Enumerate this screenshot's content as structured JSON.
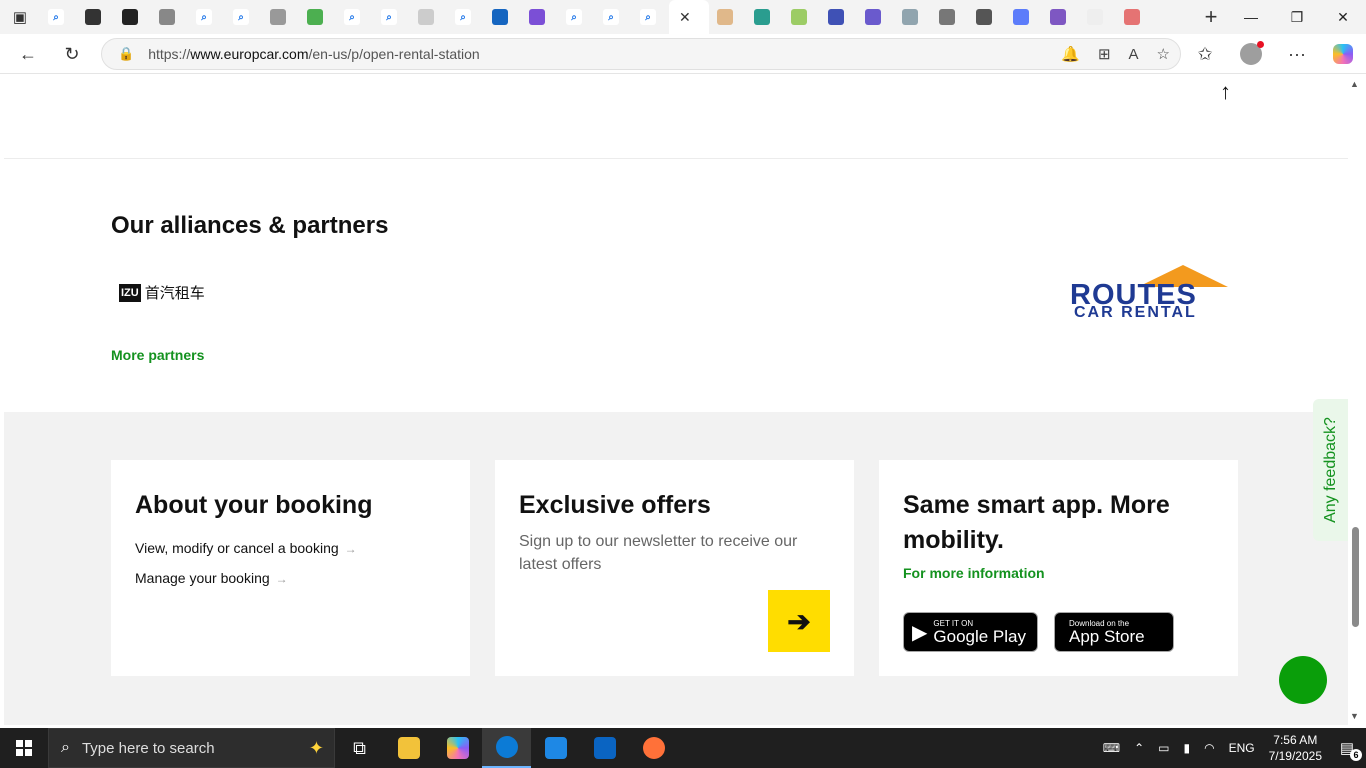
{
  "browser": {
    "tabs": [
      {
        "icon": "search-icon",
        "color": "#ffffff"
      },
      {
        "icon": "spiral-icon",
        "color": "#333333"
      },
      {
        "icon": "b-logo-icon",
        "color": "#222222"
      },
      {
        "icon": "chart-icon",
        "color": "#888888"
      },
      {
        "icon": "search-icon",
        "color": "#ffffff"
      },
      {
        "icon": "search-icon",
        "color": "#ffffff"
      },
      {
        "icon": "n-logo-icon",
        "color": "#999999"
      },
      {
        "icon": "globe-icon",
        "color": "#4caf50"
      },
      {
        "icon": "search-icon",
        "color": "#ffffff"
      },
      {
        "icon": "search-icon",
        "color": "#ffffff"
      },
      {
        "icon": "dash-icon",
        "color": "#cccccc"
      },
      {
        "icon": "search-icon",
        "color": "#ffffff"
      },
      {
        "icon": "xf-logo-icon",
        "color": "#1565c0"
      },
      {
        "icon": "e-logo-icon",
        "color": "#7b4fd6"
      },
      {
        "icon": "search-icon",
        "color": "#ffffff"
      },
      {
        "icon": "search-icon",
        "color": "#ffffff"
      },
      {
        "icon": "search-icon",
        "color": "#ffffff"
      }
    ],
    "active_tab_close": "✕",
    "tabs_after": [
      {
        "icon": "dots-icon",
        "color": "#e0b88a"
      },
      {
        "icon": "triangle-icon",
        "color": "#2a9d8f"
      },
      {
        "icon": "circle-icon",
        "color": "#9ccc65"
      },
      {
        "icon": "gear-icon",
        "color": "#3f51b5"
      },
      {
        "icon": "u-logo-icon",
        "color": "#6a5acd"
      },
      {
        "icon": "pin-icon",
        "color": "#90a4ae"
      },
      {
        "icon": "globe-icon",
        "color": "#777777"
      },
      {
        "icon": "list-icon",
        "color": "#555555"
      },
      {
        "icon": "shield-icon",
        "color": "#5c7cfa"
      },
      {
        "icon": "puzzle-icon",
        "color": "#7e57c2"
      },
      {
        "icon": "g-logo-icon",
        "color": "#eeeeee"
      },
      {
        "icon": "image-icon",
        "color": "#e57373"
      }
    ],
    "url_prefix": "https://",
    "url_domain": "www.europcar.com",
    "url_path": "/en-us/p/open-rental-station"
  },
  "page": {
    "partners_title": "Our alliances & partners",
    "izu_badge": "IZU",
    "izu_name": "首汽租车",
    "routes_top": "ROUTES",
    "routes_bottom": "CAR RENTAL",
    "more_partners": "More partners",
    "booking": {
      "title": "About your booking",
      "link1": "View, modify or cancel a booking",
      "link2": "Manage your booking"
    },
    "offers": {
      "title": "Exclusive offers",
      "subtitle": "Sign up to our newsletter to receive our latest offers"
    },
    "app": {
      "title": "Same smart app. More mobility.",
      "more_info": "For more information",
      "google_small": "GET IT ON",
      "google_big": "Google Play",
      "apple_small": "Download on the",
      "apple_big": "App Store"
    },
    "feedback": "Any feedback?"
  },
  "taskbar": {
    "search_placeholder": "Type here to search",
    "language": "ENG",
    "time": "7:56 AM",
    "date": "7/19/2025",
    "notifications": "6"
  },
  "colors": {
    "accent_green": "#14921f",
    "cta_yellow": "#ffdd00",
    "routes_blue": "#1f3a93",
    "routes_orange": "#f39a1e"
  }
}
